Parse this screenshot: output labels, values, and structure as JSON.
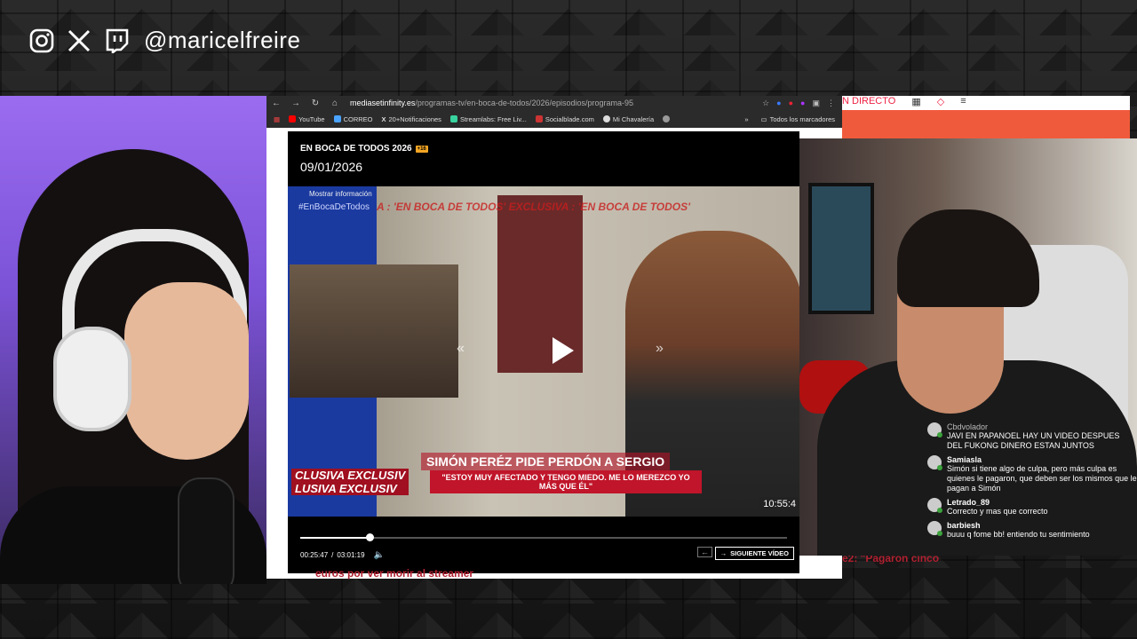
{
  "overlay": {
    "handle": "@maricelfreire",
    "social_icons": [
      "instagram-icon",
      "x-icon",
      "twitch-icon"
    ]
  },
  "browser": {
    "url_domain": "mediasetinfinity.es",
    "url_path": "/programas-tv/en-boca-de-todos/2026/episodios/programa-95...",
    "bookmarks": [
      "YouTube",
      "CORREO",
      "20+Notificaciones",
      "Streamlabs: Free Liv...",
      "Socialblade.com",
      "Mi Chavalería"
    ],
    "all_bookmarks": "Todos los marcadores",
    "site_nav": "N DIRECTO"
  },
  "player": {
    "program": "EN BOCA DE TODOS 2026",
    "age_badge": "+16",
    "date": "09/01/2026",
    "show_info": "Mostrar información",
    "hashtag": "#EnBocaDeTodos",
    "ticker": "A : 'EN BOCA DE TODOS'   EXCLUSIVA : 'EN BOCA DE TODOS'",
    "headline": "SIMÓN PERÉZ PIDE PERDÓN A SERGIO",
    "quote": "\"ESTOY MUY AFECTADO Y TENGO MIEDO. ME LO MEREZCO YO MÁS QUE ÉL\"",
    "exclusive_1": "CLUSIVA   EXCLUSIV",
    "exclusive_2": "LUSIVA   EXCLUSIV",
    "onscreen_clock": "10:55:4",
    "current_time": "00:25:47",
    "separator": "/",
    "duration": "03:01:19",
    "progress": 0.143,
    "next_label": "SIGUIENTE VÍDEO"
  },
  "page_text": {
    "below_player": "euros por ver morir al streamer",
    "side_headline": "e2: \"Pagaron cinco"
  },
  "chat": [
    {
      "user": "Cbdvolador",
      "text": "JAVI EN PAPANOEL HAY UN VIDEO DESPUES DEL FUKONG DINERO ESTAN JUNTOS",
      "faded": true
    },
    {
      "user": "Samiasla",
      "text": "Simón si tiene algo de culpa, pero más culpa es quienes le pagaron, que deben ser los mismos que le pagan a Simón",
      "faded": false
    },
    {
      "user": "Letrado_89",
      "text": "Correcto y mas que correcto",
      "faded": false
    },
    {
      "user": "barbiesh",
      "text": "buuu q fome bb! entiendo tu sentimiento",
      "faded": false
    }
  ]
}
